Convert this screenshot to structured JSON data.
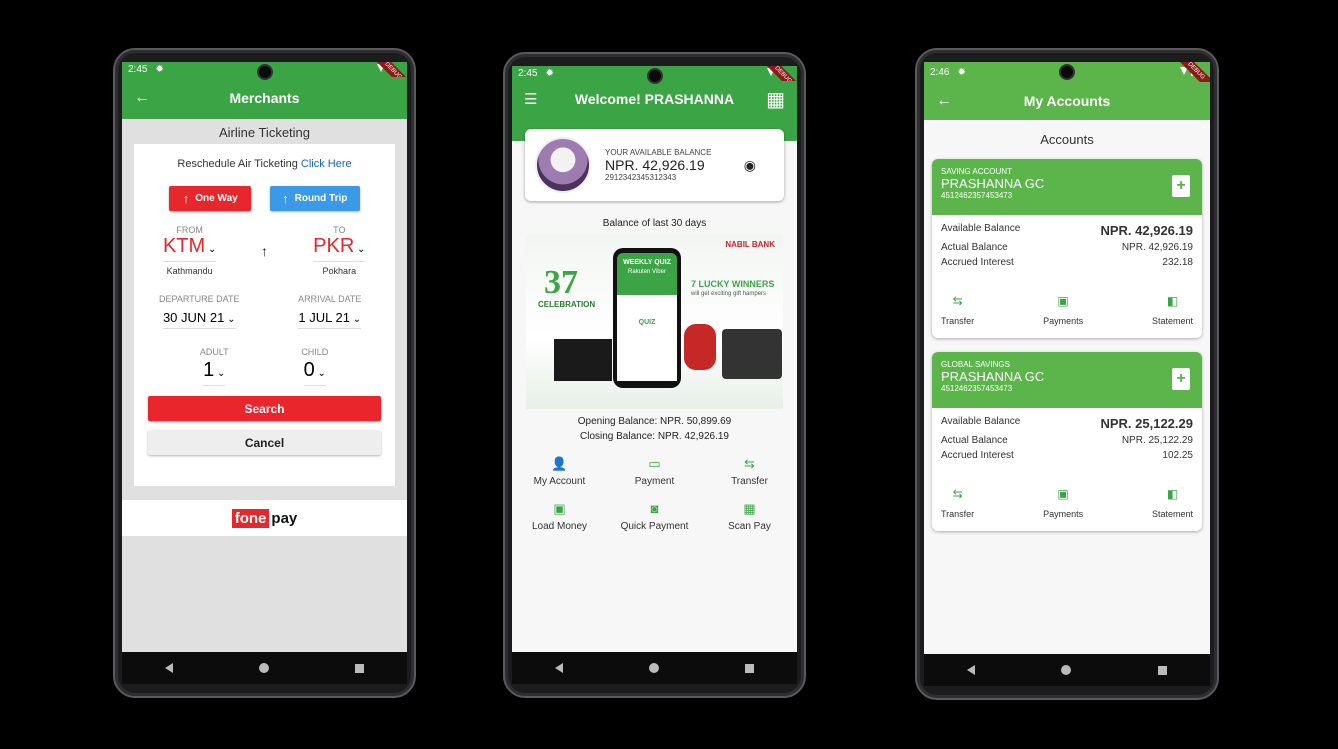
{
  "phone1": {
    "status_time": "2:45",
    "debug": "DEBUG",
    "title": "Merchants",
    "subtitle": "Airline Ticketing",
    "reschedule_text": "Reschedule Air Ticketing",
    "reschedule_link": "Click Here",
    "one_way": "One Way",
    "round_trip": "Round Trip",
    "from_label": "FROM",
    "to_label": "TO",
    "from_code": "KTM",
    "from_city": "Kathmandu",
    "to_code": "PKR",
    "to_city": "Pokhara",
    "departure_label": "DEPARTURE DATE",
    "arrival_label": "ARRIVAL DATE",
    "departure_date": "30 JUN 21",
    "arrival_date": "1 JUL 21",
    "adult_label": "ADULT",
    "child_label": "CHILD",
    "adult_count": "1",
    "child_count": "0",
    "search": "Search",
    "cancel": "Cancel",
    "fonepay_a": "fone",
    "fonepay_b": "pay",
    "colors": {
      "accent": "#3ba546",
      "danger": "#e8262b",
      "blue": "#3b9ae8"
    }
  },
  "phone2": {
    "status_time": "2:45",
    "debug": "DEBUG",
    "title": "Welcome! PRASHANNA",
    "balance_label": "YOUR AVAILABLE BALANCE",
    "balance": "NPR. 42,926.19",
    "account_number": "2912342345312343",
    "last30": "Balance of last 30 days",
    "banner": {
      "bank": "NABIL BANK",
      "celebration": "CELEBRATION",
      "weekly_quiz": "WEEKLY QUIZ",
      "viber": "Rakuten Viber",
      "winners": "7 LUCKY WINNERS",
      "gift": "will get exciting gift hampers",
      "quiz": "QUIZ"
    },
    "opening_balance": "Opening Balance: NPR. 50,899.69",
    "closing_balance": "Closing Balance: NPR. 42,926.19",
    "actions": [
      {
        "icon": "person-icon",
        "glyph": "👤",
        "label": "My Account"
      },
      {
        "icon": "card-icon",
        "glyph": "▭",
        "label": "Payment"
      },
      {
        "icon": "transfer-icon",
        "glyph": "⇆",
        "label": "Transfer"
      },
      {
        "icon": "money-icon",
        "glyph": "▣",
        "label": "Load Money"
      },
      {
        "icon": "quick-pay-icon",
        "glyph": "◙",
        "label": "Quick Payment"
      },
      {
        "icon": "qr-icon",
        "glyph": "▦",
        "label": "Scan Pay"
      }
    ]
  },
  "phone3": {
    "status_time": "2:46",
    "debug": "DEBUG",
    "title": "My Accounts",
    "section": "Accounts",
    "accounts": [
      {
        "type": "SAVING ACCOUNT",
        "name": "PRASHANNA GC",
        "number": "4512462357453473",
        "available_label": "Available Balance",
        "available": "NPR. 42,926.19",
        "actual_label": "Actual Balance",
        "actual": "NPR. 42,926.19",
        "interest_label": "Accrued Interest",
        "interest": "232.18",
        "transfer": "Transfer",
        "payments": "Payments",
        "statement": "Statement"
      },
      {
        "type": "GLOBAL SAVINGS",
        "name": "PRASHANNA GC",
        "number": "4512462357453473",
        "available_label": "Available Balance",
        "available": "NPR. 25,122.29",
        "actual_label": "Actual Balance",
        "actual": "NPR. 25,122.29",
        "interest_label": "Accrued Interest",
        "interest": "102.25",
        "transfer": "Transfer",
        "payments": "Payments",
        "statement": "Statement"
      }
    ]
  }
}
